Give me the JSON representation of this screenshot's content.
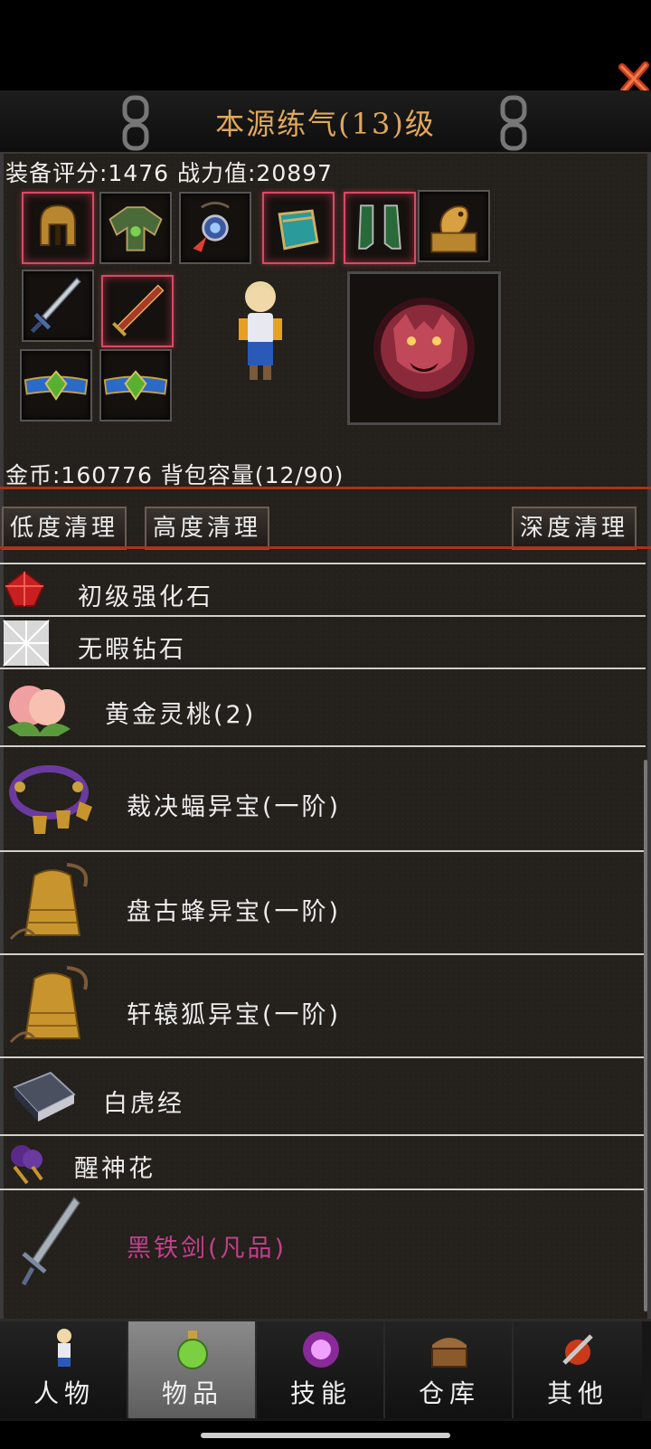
{
  "header": {
    "title": "本源练气(13)级"
  },
  "stats": {
    "score_line": "装备评分:1476 战力值:20897",
    "gold_line": "金币:160776 背包容量(12/90)"
  },
  "equipment": {
    "slots": [
      {
        "icon": "golden-helmet-icon"
      },
      {
        "icon": "armor-shoulder-icon"
      },
      {
        "icon": "amulet-icon"
      },
      {
        "icon": "bracer-icon"
      },
      {
        "icon": "boots-icon"
      },
      {
        "icon": "golden-dragon-seal-icon"
      },
      {
        "icon": "sword-icon"
      },
      {
        "icon": "red-blade-icon"
      },
      {
        "icon": "belt-icon"
      },
      {
        "icon": "belt-icon"
      }
    ],
    "mount_icon": "tiger-emblem-icon",
    "character_icon": "player-avatar-icon"
  },
  "clean_buttons": [
    {
      "label": "低度清理"
    },
    {
      "label": "高度清理"
    },
    {
      "label": "深度清理"
    }
  ],
  "items": [
    {
      "name": "初级强化石",
      "icon": "red-gem-icon"
    },
    {
      "name": "无暇钻石",
      "icon": "diamond-icon"
    },
    {
      "name": "黄金灵桃(2)",
      "icon": "peach-icon"
    },
    {
      "name": "裁决蝠异宝(一阶)",
      "icon": "bell-bracelet-icon"
    },
    {
      "name": "盘古蜂异宝(一阶)",
      "icon": "golden-bell-icon"
    },
    {
      "name": "轩辕狐异宝(一阶)",
      "icon": "golden-bell-icon"
    },
    {
      "name": "白虎经",
      "icon": "book-icon"
    },
    {
      "name": "醒神花",
      "icon": "purple-flower-icon"
    },
    {
      "name": "黑铁剑(凡品)",
      "icon": "iron-sword-icon",
      "color": "#c2408e"
    }
  ],
  "tabs": [
    {
      "label": "人物",
      "icon": "character-icon",
      "active": false
    },
    {
      "label": "物品",
      "icon": "potion-icon",
      "active": true
    },
    {
      "label": "技能",
      "icon": "skill-orb-icon",
      "active": false
    },
    {
      "label": "仓库",
      "icon": "chest-icon",
      "active": false
    },
    {
      "label": "其他",
      "icon": "other-icon",
      "active": false
    }
  ],
  "colors": {
    "title": "#e0a85a",
    "accent_line": "#a8321e",
    "common_item": "#c2408e"
  }
}
